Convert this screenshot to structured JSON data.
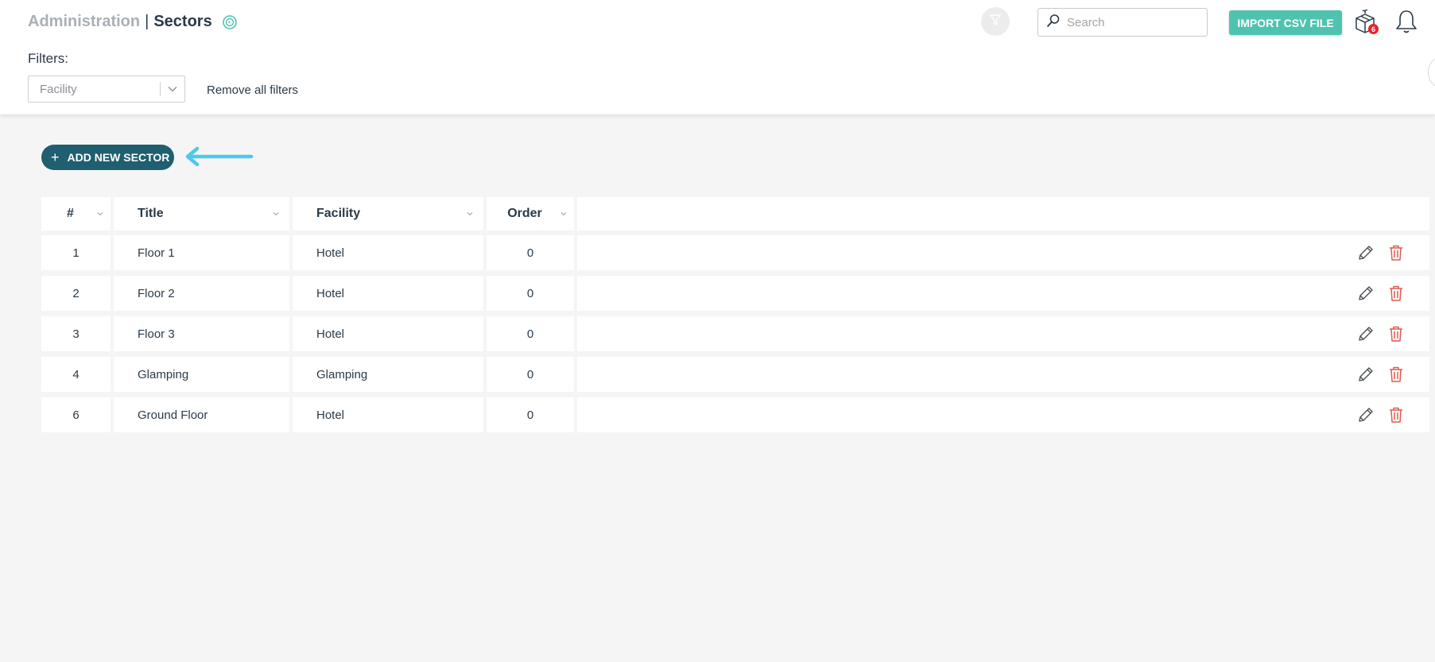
{
  "header": {
    "breadcrumb_parent": "Administration",
    "breadcrumb_separator": "|",
    "page_title": "Sectors",
    "search_placeholder": "Search",
    "import_label": "IMPORT CSV FILE",
    "gift_badge_count": "6"
  },
  "filters": {
    "label": "Filters:",
    "facility_placeholder": "Facility",
    "remove_all_label": "Remove all filters"
  },
  "actions": {
    "add_label": "ADD NEW SECTOR"
  },
  "table": {
    "columns": [
      "#",
      "Title",
      "Facility",
      "Order"
    ],
    "rows": [
      {
        "num": "1",
        "title": "Floor 1",
        "facility": "Hotel",
        "order": "0"
      },
      {
        "num": "2",
        "title": "Floor 2",
        "facility": "Hotel",
        "order": "0"
      },
      {
        "num": "3",
        "title": "Floor 3",
        "facility": "Hotel",
        "order": "0"
      },
      {
        "num": "4",
        "title": "Glamping",
        "facility": "Glamping",
        "order": "0"
      },
      {
        "num": "6",
        "title": "Ground Floor",
        "facility": "Hotel",
        "order": "0"
      }
    ]
  },
  "colors": {
    "accent": "#4fc3b0",
    "primary_dark": "#1f5f6f",
    "delete": "#e05a4f",
    "annotation_arrow": "#4fc8ee"
  },
  "icons": {
    "help": "help-circle-icon",
    "filter": "funnel-icon",
    "search": "search-icon",
    "gift": "gift-box-icon",
    "bell": "bell-icon",
    "edit": "pencil-icon",
    "delete": "trash-icon",
    "sort": "chevron-down-icon"
  }
}
